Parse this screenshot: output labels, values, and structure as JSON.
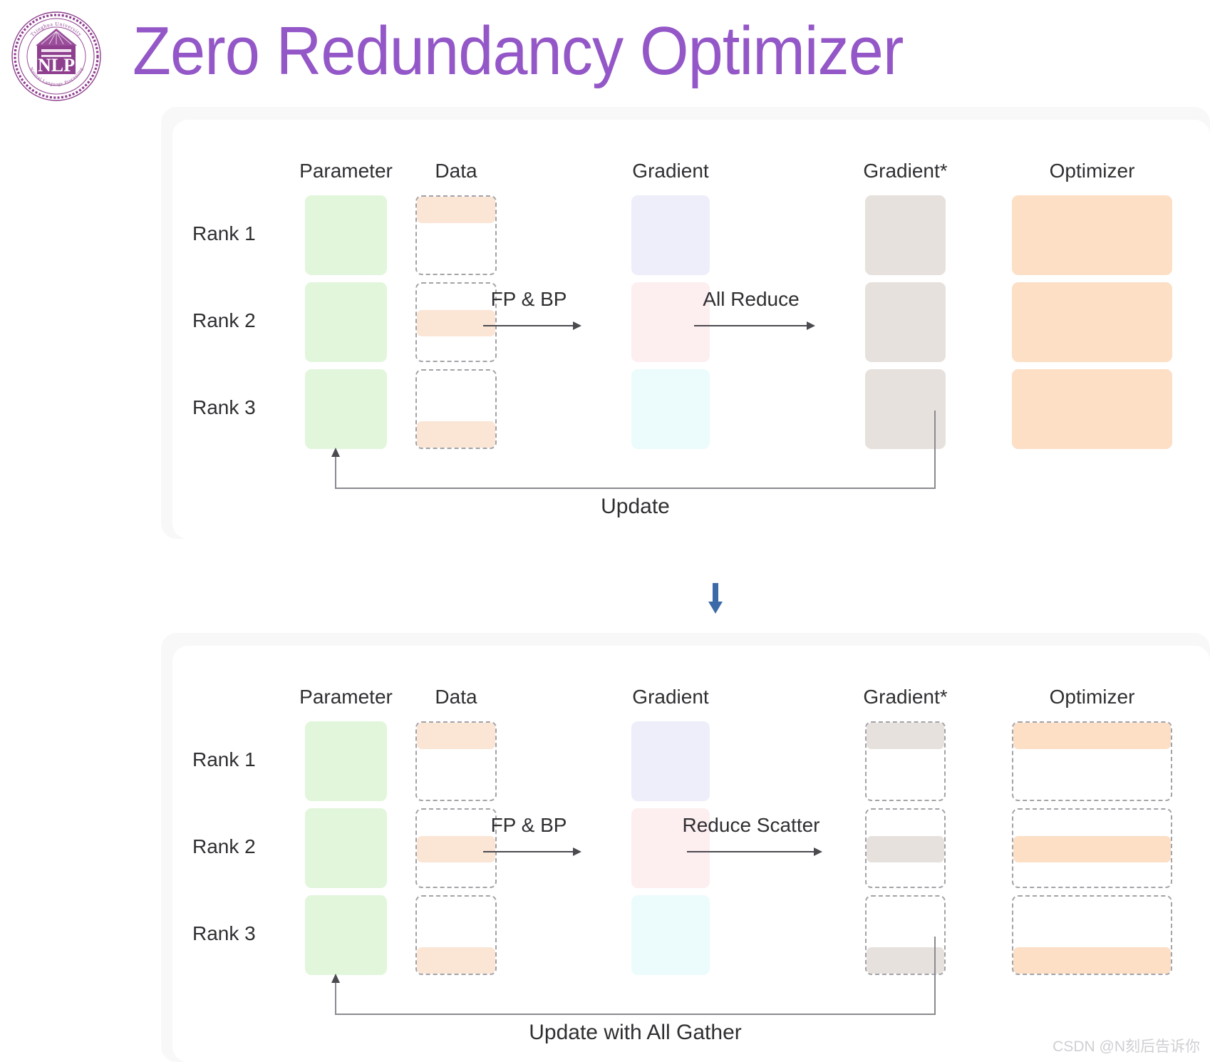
{
  "header": {
    "title": "Zero Redundancy Optimizer",
    "title_color": "#9457c8",
    "logo_name": "tsinghua-nlp-logo",
    "logo_text_outer_top": "Tsinghua University",
    "logo_text_outer_bottom": "Natural Language Processing",
    "logo_text_center": "NLP"
  },
  "watermark": "CSDN @N刻后告诉你",
  "colors": {
    "parameter_fill": "#e2f6dc",
    "data_fill": "#fbe5d5",
    "gradient_rank1": "#eeeefb",
    "gradient_rank2": "#fdeef0",
    "gradient_rank3": "#ecfbfb",
    "gradient_star_fill": "#e6e1dd",
    "optimizer_fill": "#fcdfc5",
    "dashed_border": "#a3a3a8",
    "panel_outer": "#f8f8f9",
    "panel_inner": "#ffffff",
    "arrow": "#4a4a4f",
    "blue_arrow": "#3c6aa8",
    "text": "#2f2f33"
  },
  "panels": [
    {
      "id": "panel-1",
      "columns": [
        {
          "key": "parameter",
          "label": "Parameter"
        },
        {
          "key": "data",
          "label": "Data"
        },
        {
          "key": "gradient",
          "label": "Gradient"
        },
        {
          "key": "gradient_star",
          "label": "Gradient*"
        },
        {
          "key": "optimizer",
          "label": "Optimizer"
        }
      ],
      "ranks": [
        "Rank 1",
        "Rank 2",
        "Rank 3"
      ],
      "flows": [
        {
          "key": "fp-bp",
          "label": "FP & BP"
        },
        {
          "key": "all-reduce",
          "label": "All Reduce"
        }
      ],
      "update": {
        "label": "Update"
      },
      "cells": {
        "parameter": [
          "solid",
          "solid",
          "solid"
        ],
        "data": [
          "band-top",
          "band-middle",
          "band-bottom"
        ],
        "gradient": [
          "solid",
          "solid",
          "solid"
        ],
        "gradient_star": [
          "solid",
          "solid",
          "solid"
        ],
        "optimizer": [
          "solid",
          "solid",
          "solid"
        ]
      }
    },
    {
      "id": "panel-2",
      "columns": [
        {
          "key": "parameter",
          "label": "Parameter"
        },
        {
          "key": "data",
          "label": "Data"
        },
        {
          "key": "gradient",
          "label": "Gradient"
        },
        {
          "key": "gradient_star",
          "label": "Gradient*"
        },
        {
          "key": "optimizer",
          "label": "Optimizer"
        }
      ],
      "ranks": [
        "Rank 1",
        "Rank 2",
        "Rank 3"
      ],
      "flows": [
        {
          "key": "fp-bp",
          "label": "FP & BP"
        },
        {
          "key": "reduce-scatter",
          "label": "Reduce Scatter"
        }
      ],
      "update": {
        "label": "Update with All Gather"
      },
      "cells": {
        "parameter": [
          "solid",
          "solid",
          "solid"
        ],
        "data": [
          "band-top",
          "band-middle",
          "band-bottom"
        ],
        "gradient": [
          "solid",
          "solid",
          "solid"
        ],
        "gradient_star": [
          "band-top",
          "band-middle",
          "band-bottom"
        ],
        "optimizer": [
          "band-top",
          "band-middle",
          "band-bottom"
        ]
      }
    }
  ]
}
